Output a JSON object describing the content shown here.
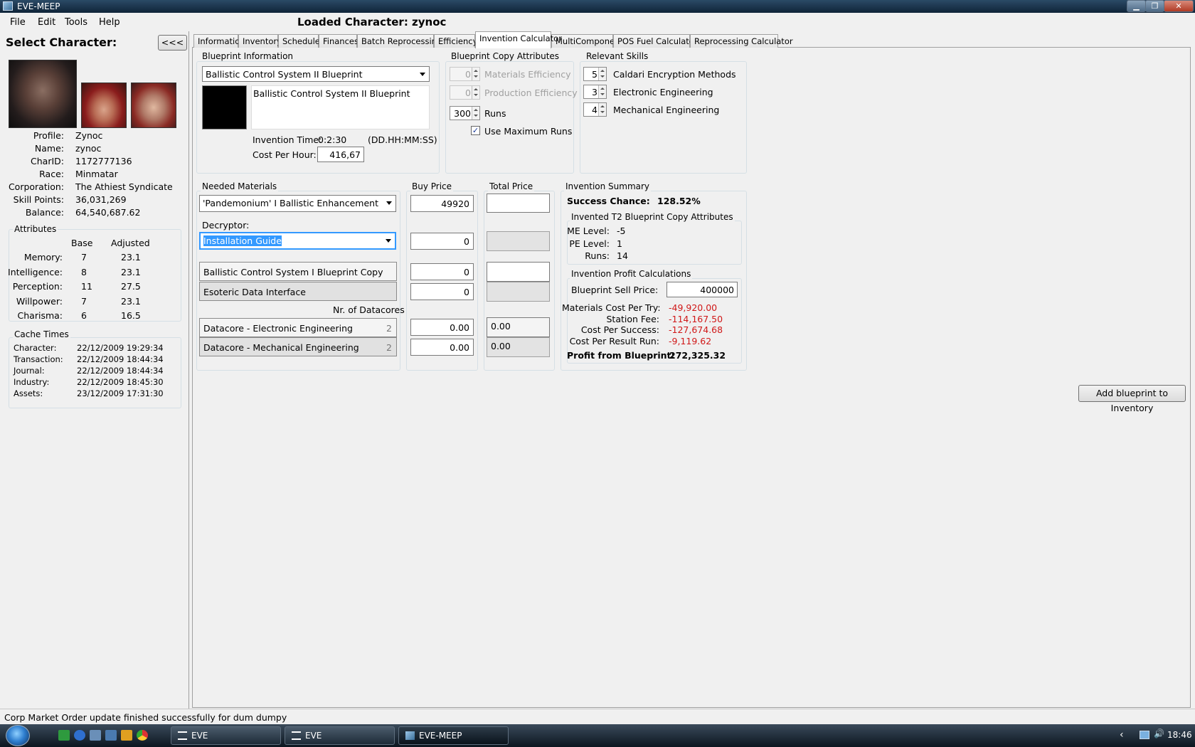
{
  "window": {
    "title": "EVE-MEEP",
    "minimize": "▁",
    "restore": "❐",
    "close": "✕"
  },
  "menu": [
    "File",
    "Edit",
    "Tools",
    "Help"
  ],
  "loaded_character": "Loaded Character: zynoc",
  "left": {
    "select_title": "Select Character:",
    "collapse_button": "<<<",
    "info": [
      {
        "label": "Profile:",
        "value": "Zynoc"
      },
      {
        "label": "Name:",
        "value": "zynoc"
      },
      {
        "label": "CharID:",
        "value": "1172777136"
      },
      {
        "label": "Race:",
        "value": "Minmatar"
      },
      {
        "label": "Corporation:",
        "value": "The Athiest Syndicate"
      },
      {
        "label": "Skill Points:",
        "value": "36,031,269"
      },
      {
        "label": "Balance:",
        "value": "64,540,687.62"
      }
    ],
    "attributes": {
      "title": "Attributes",
      "col_base": "Base",
      "col_adjusted": "Adjusted",
      "rows": [
        {
          "name": "Memory:",
          "base": "7",
          "adjusted": "23.1"
        },
        {
          "name": "Intelligence:",
          "base": "8",
          "adjusted": "23.1"
        },
        {
          "name": "Perception:",
          "base": "11",
          "adjusted": "27.5"
        },
        {
          "name": "Willpower:",
          "base": "7",
          "adjusted": "23.1"
        },
        {
          "name": "Charisma:",
          "base": "6",
          "adjusted": "16.5"
        }
      ]
    },
    "cache": {
      "title": "Cache Times",
      "rows": [
        {
          "name": "Character:",
          "value": "22/12/2009 19:29:34"
        },
        {
          "name": "Transaction:",
          "value": "22/12/2009 18:44:34"
        },
        {
          "name": "Journal:",
          "value": "22/12/2009 18:44:34"
        },
        {
          "name": "Industry:",
          "value": "22/12/2009 18:45:30"
        },
        {
          "name": "Assets:",
          "value": "23/12/2009 17:31:30"
        }
      ]
    }
  },
  "tabs": [
    "Information",
    "Inventory",
    "Schedule",
    "Finances",
    "Batch Reprocessing",
    "Efficiency",
    "Invention Calculator",
    "MultiComponent",
    "POS Fuel Calculator",
    "Reprocessing Calculator"
  ],
  "active_tab": "Invention Calculator",
  "blueprint_info": {
    "title": "Blueprint Information",
    "selected": "Ballistic Control System II Blueprint",
    "name": "Ballistic Control System II Blueprint",
    "invention_time_label": "Invention Time:",
    "invention_time": "0:2:30",
    "time_format": "(DD.HH:MM:SS)",
    "cost_per_hour_label": "Cost Per Hour:",
    "cost_per_hour": "416,67"
  },
  "copy_attributes": {
    "title": "Blueprint Copy Attributes",
    "me_value": "0",
    "me_label": "Materials Efficiency",
    "pe_value": "0",
    "pe_label": "Production Efficiency",
    "runs_value": "300",
    "runs_label": "Runs",
    "use_max_label": "Use Maximum Runs",
    "use_max_checked": true,
    "check_mark": "✓"
  },
  "skills": {
    "title": "Relevant Skills",
    "items": [
      {
        "level": "5",
        "name": "Caldari Encryption Methods"
      },
      {
        "level": "3",
        "name": "Electronic Engineering"
      },
      {
        "level": "4",
        "name": "Mechanical Engineering"
      }
    ]
  },
  "materials": {
    "title": "Needed Materials",
    "buy_price_title": "Buy Price",
    "total_price_title": "Total Price",
    "enhancement": "'Pandemonium' I Ballistic Enhancement",
    "enhancement_price": "49920",
    "decryptor_label": "Decryptor:",
    "decryptor": "Installation Guide",
    "decryptor_price": "0",
    "items": [
      {
        "name": "Ballistic Control System I Blueprint Copy",
        "price": "0"
      },
      {
        "name": "Esoteric Data Interface",
        "price": "0"
      }
    ],
    "datacores_label": "Nr. of Datacores",
    "datacores": [
      {
        "name": "Datacore - Electronic Engineering",
        "count": "2",
        "price": "0.00",
        "total": "0.00"
      },
      {
        "name": "Datacore - Mechanical Engineering",
        "count": "2",
        "price": "0.00",
        "total": "0.00"
      }
    ]
  },
  "summary": {
    "title": "Invention Summary",
    "success_label": "Success Chance:",
    "success_value": "128.52%",
    "t2_title": "Invented T2 Blueprint Copy Attributes",
    "me_label": "ME Level:",
    "me_value": "-5",
    "pe_label": "PE Level:",
    "pe_value": "1",
    "runs_label": "Runs:",
    "runs_value": "14",
    "profit_title": "Invention Profit Calculations",
    "sell_label": "Blueprint Sell Price:",
    "sell_value": "400000",
    "calc": [
      {
        "label": "Materials Cost Per Try:",
        "value": "-49,920.00"
      },
      {
        "label": "Station Fee:",
        "value": "-114,167.50"
      },
      {
        "label": "Cost Per Success:",
        "value": "-127,674.68"
      },
      {
        "label": "Cost Per Result Run:",
        "value": "-9,119.62"
      }
    ],
    "profit_label": "Profit from Blueprint:",
    "profit_value": "272,325.32"
  },
  "add_button": "Add blueprint to Inventory",
  "status": "Corp Market Order update finished successfully for dum dumpy",
  "taskbar": {
    "items": [
      "EVE",
      "EVE",
      "EVE-MEEP"
    ],
    "clock": "18:46",
    "tray_arrow": "‹",
    "volume": "🔊"
  },
  "colors": {
    "negative": "#d01818",
    "titlebar": "#1c3650",
    "selection": "#3399ff"
  }
}
